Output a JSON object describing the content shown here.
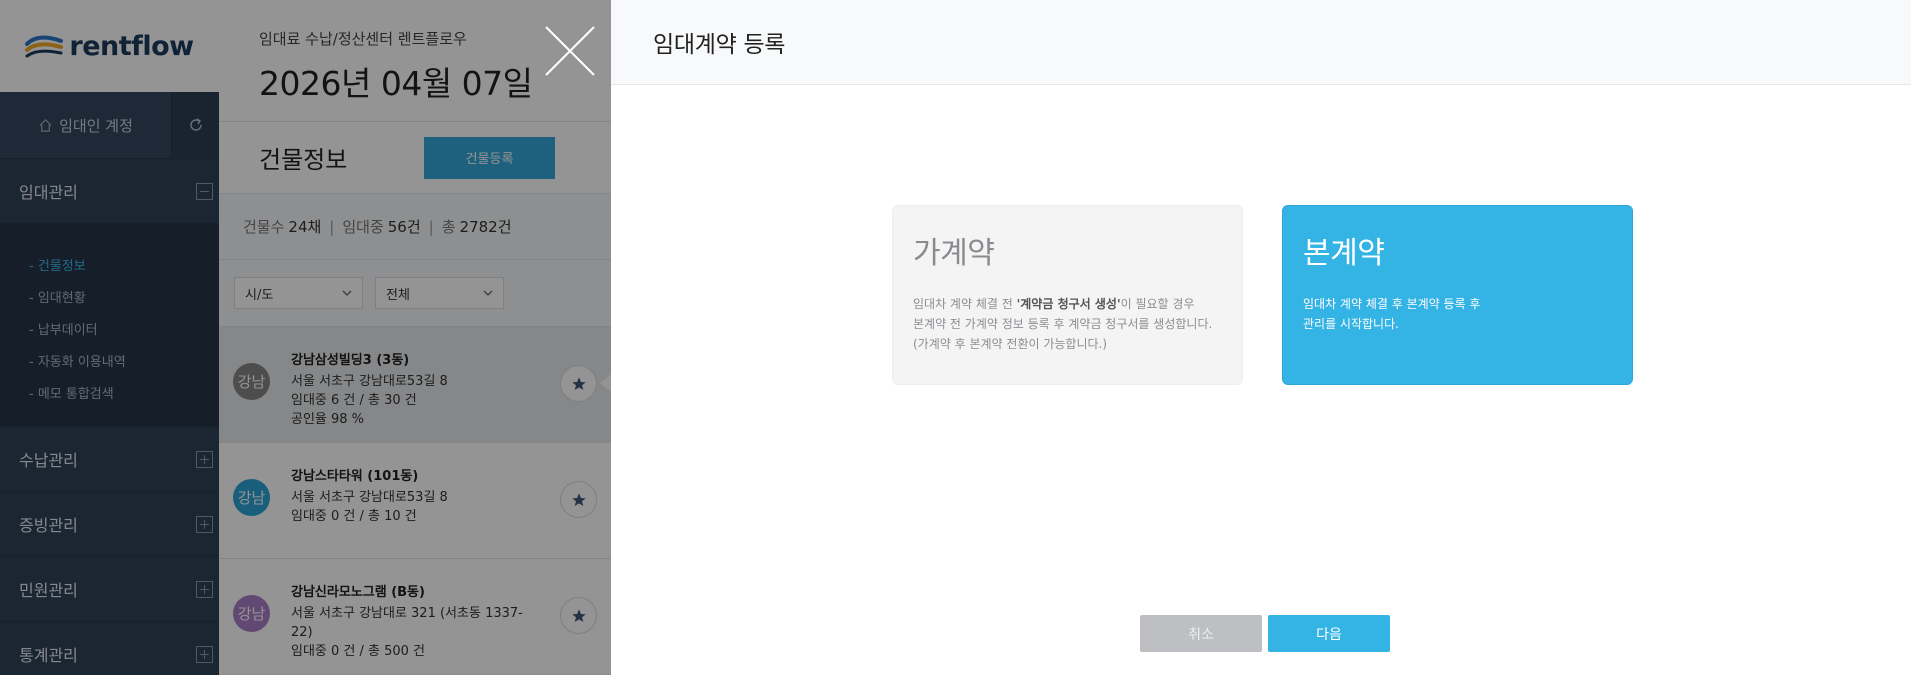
{
  "brand": {
    "name": "rentflow"
  },
  "sidebar": {
    "account_label": "임대인 계정",
    "menus": [
      {
        "label": "임대관리",
        "expanded": true
      },
      {
        "label": "수납관리",
        "expanded": false
      },
      {
        "label": "증빙관리",
        "expanded": false
      },
      {
        "label": "민원관리",
        "expanded": false
      },
      {
        "label": "통계관리",
        "expanded": false
      }
    ],
    "submenu": [
      {
        "label": "- 건물정보",
        "active": true
      },
      {
        "label": "- 임대현황",
        "active": false
      },
      {
        "label": "- 납부데이터",
        "active": false
      },
      {
        "label": "- 자동화 이용내역",
        "active": false
      },
      {
        "label": "- 메모 통합검색",
        "active": false
      }
    ]
  },
  "header": {
    "center_name": "임대료 수납/정산센터 렌트플로우",
    "date": "2026년 04월 07일"
  },
  "buildings_panel": {
    "title": "건물정보",
    "register_label": "건물등록",
    "stats": {
      "count_label": "건물수",
      "count_value": "24채",
      "renting_label": "임대중",
      "renting_value": "56건",
      "total_label": "총",
      "total_value": "2782건"
    },
    "filters": [
      {
        "value": "시/도"
      },
      {
        "value": "전체"
      }
    ],
    "buildings": [
      {
        "avatar": "강남",
        "avatar_color": "#858585",
        "name": "강남삼성빌딩3 (3동)",
        "address": "서울 서초구 강남대로53길 8",
        "units": "임대중 6 건 / 총 30 건",
        "extra": "공인율 98 %",
        "active": true
      },
      {
        "avatar": "강남",
        "avatar_color": "#2ba4d6",
        "name": "강남스타타워 (101동)",
        "address": "서울 서초구 강남대로53길 8",
        "units": "임대중 0 건 / 총 10 건",
        "extra": "",
        "active": false
      },
      {
        "avatar": "강남",
        "avatar_color": "#a87fc9",
        "name": "강남신라모노그램 (B동)",
        "address": "서울 서초구 강남대로 321 (서초동 1337-22)",
        "units": "임대중 0 건 / 총 500 건",
        "extra": "",
        "active": false
      }
    ]
  },
  "modal": {
    "title": "임대계약 등록",
    "options": [
      {
        "title": "가계약",
        "desc_pre": "임대차 계약 체결 전 ",
        "desc_bold": "'계약금 청구서 생성'",
        "desc_post": "이 필요할 경우",
        "desc_line2": "본계약 전 가계약 정보 등록 후 계약금 청구서를 생성합니다.",
        "desc_line3": "(가계약 후 본계약 전환이 가능합니다.)"
      },
      {
        "title": "본계약",
        "desc_line1": "임대차 계약 체결 후 본계약 등록 후",
        "desc_line2": "관리를 시작합니다."
      }
    ],
    "cancel_label": "취소",
    "next_label": "다음"
  },
  "colors": {
    "accent": "#34b3e5",
    "sidebar": "#2f4259",
    "active_menu": "#3db4e8"
  }
}
